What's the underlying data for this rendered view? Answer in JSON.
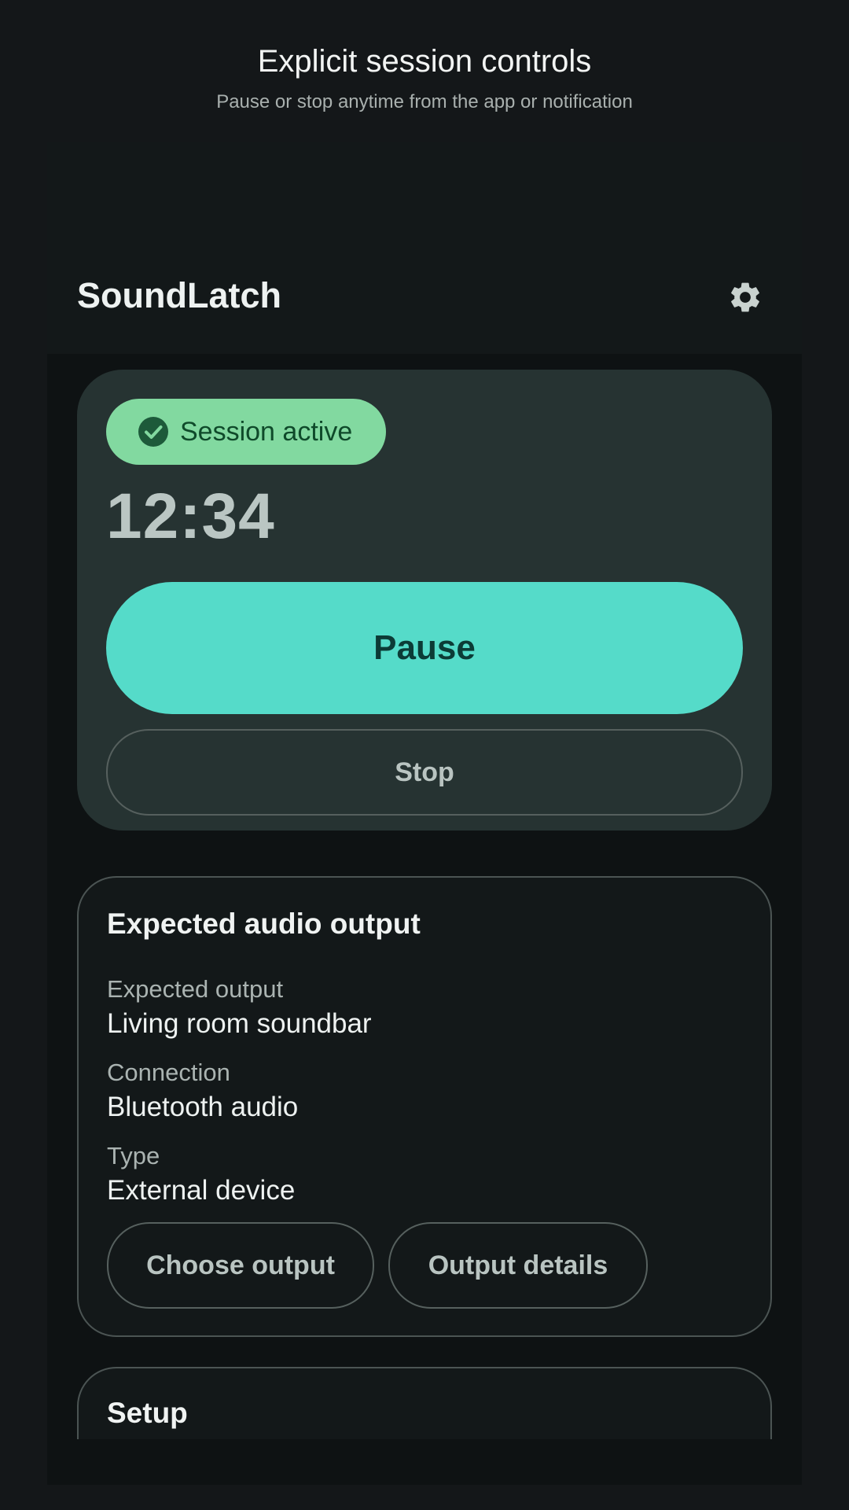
{
  "caption": {
    "title": "Explicit session controls",
    "subtitle": "Pause or stop anytime from the app or notification"
  },
  "app": {
    "title": "SoundLatch",
    "settings_icon": "gear-icon"
  },
  "session": {
    "status_label": "Session active",
    "status_icon": "check-circle-icon",
    "timer": "12:34",
    "pause_label": "Pause",
    "stop_label": "Stop"
  },
  "output": {
    "title": "Expected audio output",
    "fields": [
      {
        "label": "Expected output",
        "value": "Living room soundbar"
      },
      {
        "label": "Connection",
        "value": "Bluetooth audio"
      },
      {
        "label": "Type",
        "value": "External device"
      }
    ],
    "choose_label": "Choose output",
    "details_label": "Output details"
  },
  "setup": {
    "title": "Setup"
  },
  "colors": {
    "accent": "#55dbc9",
    "status_chip": "#82d9a0",
    "card_surface": "#263332",
    "background": "#141719"
  }
}
